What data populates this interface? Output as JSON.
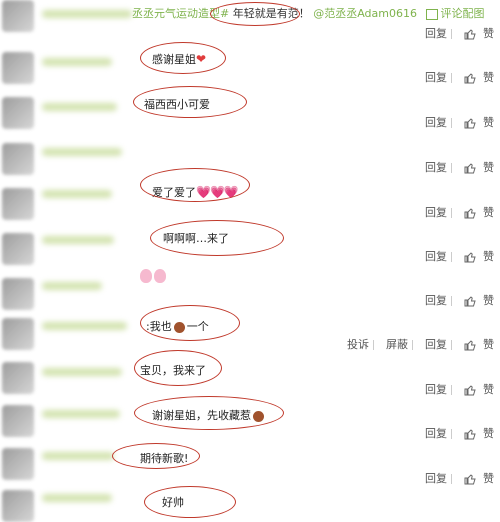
{
  "top": {
    "topic": "丞丞元气运动造型#",
    "text": "年轻就是有范！",
    "mention": "@范丞丞Adam0616",
    "pic_label": "评论配图"
  },
  "actions": {
    "reply": "回复",
    "like": "赞",
    "report": "投诉",
    "block": "屏蔽"
  },
  "comments": [
    {
      "text": "感谢星姐"
    },
    {
      "text": "福西西小可爱"
    },
    {
      "text": "爱了爱了"
    },
    {
      "text": "啊啊啊…来了"
    },
    {
      "text": ":我也"
    },
    {
      "text": "一个"
    },
    {
      "text": "宝贝，我来了"
    },
    {
      "text": "谢谢星姐，先收藏惹"
    },
    {
      "text": "期待新歌!"
    },
    {
      "text": "好帅"
    }
  ]
}
